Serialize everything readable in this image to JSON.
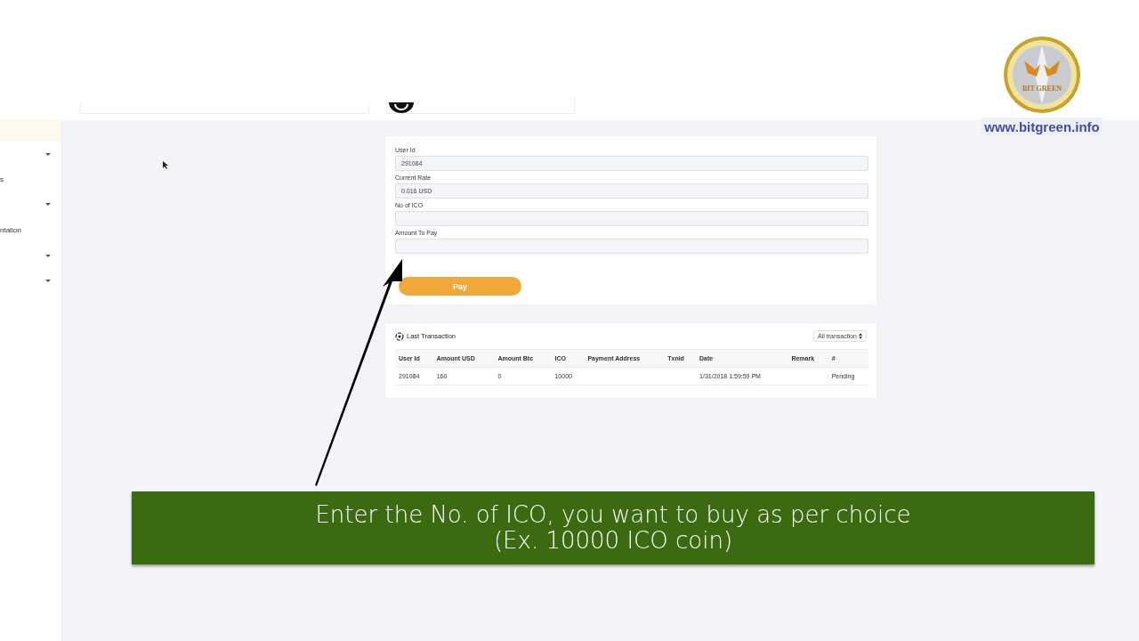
{
  "brand": {
    "coin_text": "BIT GREEN",
    "website": "www.bitgreen.info"
  },
  "sidebar": {
    "items": [
      {
        "selected": true,
        "has_caret": false
      },
      {
        "selected": false,
        "has_caret": true
      },
      {
        "label": "s",
        "selected": false,
        "has_caret": false
      },
      {
        "selected": false,
        "has_caret": true
      },
      {
        "label": "ntation",
        "selected": false,
        "has_caret": false
      },
      {
        "selected": false,
        "has_caret": true
      },
      {
        "selected": false,
        "has_caret": true
      }
    ]
  },
  "form": {
    "fields": [
      {
        "label": "User Id",
        "value": "291084"
      },
      {
        "label": "Current Rate",
        "value": "0.016 USD"
      },
      {
        "label": "No of ICO"
      },
      {
        "label": "Amount To Pay"
      }
    ],
    "button": "Pay"
  },
  "transactions": {
    "title": "Last Transaction",
    "filter": "All transaction",
    "columns": [
      "User Id",
      "Amount USD",
      "Amount Btc",
      "ICO",
      "Payment Address",
      "Txnid",
      "Date",
      "Remark",
      "#"
    ],
    "rows": [
      [
        "291084",
        "160",
        "0",
        "10000",
        "",
        "",
        "1/31/2018 1:59:59 PM",
        "",
        "Pending"
      ]
    ]
  },
  "caption": {
    "lines": [
      "Enter the No. of ICO, you want to buy as per choice",
      "(Ex. 10000 ICO coin)"
    ]
  }
}
